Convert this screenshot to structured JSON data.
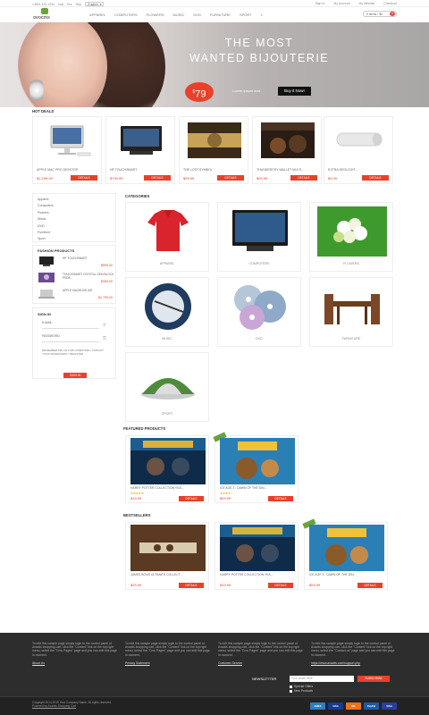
{
  "topbar": {
    "phone": "1-800-123-1234",
    "links": [
      "Usd",
      "Eur",
      "Gbp"
    ],
    "language": "English",
    "account_links": [
      "Sign In",
      "My Account",
      "My Wishlist",
      "Checkout"
    ]
  },
  "header": {
    "logo_text": "ovocms",
    "nav": [
      "Apparel",
      "Computers",
      "Flowers",
      "Music",
      "DVD",
      "Furniture",
      "Sport"
    ],
    "cart_label": "0 items / $0",
    "cart_count": "0"
  },
  "banner": {
    "headline_line1": "THE MOST",
    "headline_line2": "WANTED BIJOUTERIE",
    "price": "79",
    "price_currency": "$",
    "caption": "Lorem ipsum and",
    "button": "Buy it Now!"
  },
  "hot_deals": {
    "title": "HOT DEALS",
    "items": [
      {
        "title": "APPLE MAC PRO DESKTOP",
        "price": "$1,299.00",
        "details": "DETAILS"
      },
      {
        "title": "HP TOUCHSMART",
        "price": "$799.99",
        "details": "DETAILS"
      },
      {
        "title": "THE LOST SYMBOL",
        "price": "$29.99",
        "details": "DETAILS"
      },
      {
        "title": "THUNDERCRY WALLET MULTI...",
        "price": "$99.99",
        "details": "DETAILS"
      },
      {
        "title": "EXTRA GEOLIGHT...",
        "price": "$9.99",
        "details": "DETAILS"
      }
    ]
  },
  "sidebar": {
    "categories": [
      "Apparel",
      "Computers",
      "Flowers",
      "Music",
      "DVD",
      "Furniture",
      "Sport"
    ],
    "fashion": {
      "title": "FASHION PRODUCTS",
      "items": [
        {
          "name": "HP TOUCHSMART",
          "price": "$999.00"
        },
        {
          "name": "TOUCHSMART CRYSTAL GEM BLOCK PEDA...",
          "price": "$189.00"
        },
        {
          "name": "APPLE MACBOOK AIR",
          "price": "$1,799.00"
        }
      ]
    },
    "signin": {
      "title": "SIGN IN",
      "email_label": "E-MAIL:",
      "password_label": "PASSWORD:",
      "note": "REMEMBER ME ON THIS COMPUTER / FORGOT YOUR PASSWORD? / REGISTER",
      "button": "SIGN IN"
    }
  },
  "categories": {
    "title": "CATEGORIES",
    "items": [
      "APPAREL",
      "COMPUTERS",
      "FLOWERS",
      "MUSIC",
      "DVD",
      "FURNITURE",
      "SPORT"
    ]
  },
  "featured": {
    "title": "FEATURED PRODUCTS",
    "items": [
      {
        "title": "HARRY POTTER COLLECTION YEA...",
        "price": "$19.99",
        "details": "DETAILS",
        "stars": "★★★★★"
      },
      {
        "title": "ICE AGE 3 : DAWN OF THE DIN...",
        "price": "$29.99",
        "details": "DETAILS",
        "stars": "★★★★☆"
      }
    ]
  },
  "bestsellers": {
    "title": "BESTSELLERS",
    "items": [
      {
        "title": "JAMES BOND ULTIMATE COLLECT...",
        "price": "$29.99",
        "details": "DETAILS"
      },
      {
        "title": "HARRY POTTER COLLECTION YEA...",
        "price": "$19.99",
        "details": "DETAILS"
      },
      {
        "title": "ICE AGE 3 : DAWN OF THE DIN...",
        "price": "$29.99",
        "details": "DETAILS"
      }
    ]
  },
  "footer": {
    "columns": [
      {
        "text": "To edit this sample page simply login to the control panel of Avactis shopping cart, click the \"Content\" link on the top right menu, select the \"Cms Pages\" page and you can edit this page in moment.",
        "link": "About Us"
      },
      {
        "text": "To edit this sample page simply login to the control panel of Avactis shopping cart, click the \"Content\" link on the top right menu, select the \"Cms Pages\" page and you can edit this page in moment.",
        "link": "Privacy Statement"
      },
      {
        "text": "To edit this sample page simply login to the control panel of Avactis shopping cart, click the \"Content\" link on the top right menu, select the \"Cms Pages\" page and you can edit this page in moment.",
        "link": "Customer Service"
      },
      {
        "text": "To edit this sample page simply login to the control panel of Avactis shopping cart, click the \"Content\" link on the top right menu, select the \"Contact us\" page and you can edit this page in moment.",
        "link": "https://www.avactis.com/support.php"
      }
    ],
    "newsletter_label": "NEWSLETTER",
    "newsletter_placeholder": "Your email here",
    "subscribe": "SUBSCRIBE",
    "opt1": "Special Offers",
    "opt2": "New Products",
    "copyright": "Copyright 2014-2015 Your Company Name. All rights reserved.",
    "powered": "Powered by Avactis Shopping Cart",
    "payments": [
      "AMEX",
      "VISA",
      "MC",
      "PayPal",
      "VISA"
    ]
  },
  "colors": {
    "accent": "#e9402a",
    "brand": "#6aa33a",
    "footer": "#2d2d2d"
  }
}
